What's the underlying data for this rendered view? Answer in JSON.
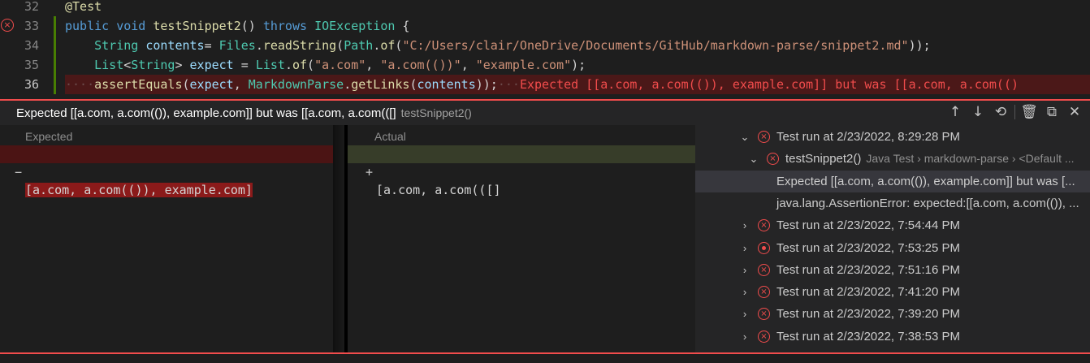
{
  "editor": {
    "lines": [
      {
        "num": "32",
        "tokens": [
          [
            "k-ann",
            "@Test"
          ]
        ]
      },
      {
        "num": "33",
        "tokens": [
          [
            "k-kw",
            "public"
          ],
          [
            "k-pl",
            " "
          ],
          [
            "k-kw",
            "void"
          ],
          [
            "k-pl",
            " "
          ],
          [
            "k-fn",
            "testSnippet2"
          ],
          [
            "k-pl",
            "() "
          ],
          [
            "k-kw",
            "throws"
          ],
          [
            "k-pl",
            " "
          ],
          [
            "k-type",
            "IOException"
          ],
          [
            "k-pl",
            " {"
          ]
        ]
      },
      {
        "num": "34",
        "tokens": [
          [
            "k-pl",
            "    "
          ],
          [
            "k-type",
            "String"
          ],
          [
            "k-pl",
            " "
          ],
          [
            "k-var",
            "contents"
          ],
          [
            "k-pl",
            "= "
          ],
          [
            "k-type",
            "Files"
          ],
          [
            "k-pl",
            "."
          ],
          [
            "k-fn",
            "readString"
          ],
          [
            "k-pl",
            "("
          ],
          [
            "k-type",
            "Path"
          ],
          [
            "k-pl",
            "."
          ],
          [
            "k-fn",
            "of"
          ],
          [
            "k-pl",
            "("
          ],
          [
            "k-str",
            "\"C:/Users/clair/OneDrive/Documents/GitHub/markdown-parse/snippet2.md\""
          ],
          [
            "k-pl",
            "));"
          ]
        ]
      },
      {
        "num": "35",
        "tokens": [
          [
            "k-pl",
            "    "
          ],
          [
            "k-type",
            "List"
          ],
          [
            "k-pl",
            "<"
          ],
          [
            "k-type",
            "String"
          ],
          [
            "k-pl",
            "> "
          ],
          [
            "k-var",
            "expect"
          ],
          [
            "k-pl",
            " = "
          ],
          [
            "k-type",
            "List"
          ],
          [
            "k-pl",
            "."
          ],
          [
            "k-fn",
            "of"
          ],
          [
            "k-pl",
            "("
          ],
          [
            "k-str",
            "\"a.com\""
          ],
          [
            "k-pl",
            ", "
          ],
          [
            "k-str",
            "\"a.com(())\""
          ],
          [
            "k-pl",
            ", "
          ],
          [
            "k-str",
            "\"example.com\""
          ],
          [
            "k-pl",
            ");"
          ]
        ]
      },
      {
        "num": "36",
        "tokens": [
          [
            "ws",
            "····"
          ],
          [
            "k-fn",
            "assertEquals"
          ],
          [
            "k-pl",
            "("
          ],
          [
            "k-var",
            "expect"
          ],
          [
            "k-pl",
            ", "
          ],
          [
            "k-type",
            "MarkdownParse"
          ],
          [
            "k-pl",
            "."
          ],
          [
            "k-fn",
            "getLinks"
          ],
          [
            "k-pl",
            "("
          ],
          [
            "k-var",
            "contents"
          ],
          [
            "k-pl",
            "));"
          ],
          [
            "ws",
            "···"
          ],
          [
            "inline-err",
            "Expected [[a.com, a.com(()), example.com]] but was [[a.com, a.com(()"
          ]
        ]
      }
    ]
  },
  "peek": {
    "title": "Expected [[a.com, a.com(()), example.com]] but was [[a.com, a.com(([]",
    "subtitle": "testSnippet2()",
    "actions": [
      {
        "name": "previous-error-icon",
        "glyph": "↑"
      },
      {
        "name": "next-error-icon",
        "glyph": "↓"
      },
      {
        "name": "history-icon",
        "glyph": "⟲"
      },
      {
        "name": "delete-icon",
        "glyph": "🗑"
      },
      {
        "name": "open-in-editor-icon",
        "glyph": "⧉"
      },
      {
        "name": "close-icon",
        "glyph": "✕"
      }
    ]
  },
  "diff": {
    "expected_label": "Expected",
    "actual_label": "Actual",
    "removed_mark": "−",
    "added_mark": "+",
    "expected_text": "[a.com, a.com(()), example.com]",
    "actual_text": "[a.com, a.com(([]"
  },
  "tree": {
    "rows": [
      {
        "indent": 0,
        "chevron": "⌄",
        "status": "fail",
        "label": "Test run at 2/23/2022, 8:29:28 PM",
        "desc": ""
      },
      {
        "indent": 1,
        "chevron": "⌄",
        "status": "fail",
        "label": "testSnippet2()",
        "desc": "Java Test › markdown-parse › <Default ..."
      },
      {
        "indent": 2,
        "chevron": "",
        "status": "",
        "label": "Expected [[a.com, a.com(()), example.com]] but was [...",
        "desc": "",
        "selected": true
      },
      {
        "indent": 2,
        "chevron": "",
        "status": "",
        "label": "java.lang.AssertionError: expected:[[a.com, a.com(()), ...",
        "desc": ""
      },
      {
        "indent": 0,
        "chevron": "›",
        "status": "fail",
        "label": "Test run at 2/23/2022, 7:54:44 PM",
        "desc": ""
      },
      {
        "indent": 0,
        "chevron": "›",
        "status": "run",
        "label": "Test run at 2/23/2022, 7:53:25 PM",
        "desc": ""
      },
      {
        "indent": 0,
        "chevron": "›",
        "status": "fail",
        "label": "Test run at 2/23/2022, 7:51:16 PM",
        "desc": ""
      },
      {
        "indent": 0,
        "chevron": "›",
        "status": "fail",
        "label": "Test run at 2/23/2022, 7:41:20 PM",
        "desc": ""
      },
      {
        "indent": 0,
        "chevron": "›",
        "status": "fail",
        "label": "Test run at 2/23/2022, 7:39:20 PM",
        "desc": ""
      },
      {
        "indent": 0,
        "chevron": "›",
        "status": "fail",
        "label": "Test run at 2/23/2022, 7:38:53 PM",
        "desc": ""
      }
    ]
  },
  "colors": {
    "error": "#f14c4c",
    "added_bg": "#373d29",
    "removed_bg": "#4b1414"
  }
}
